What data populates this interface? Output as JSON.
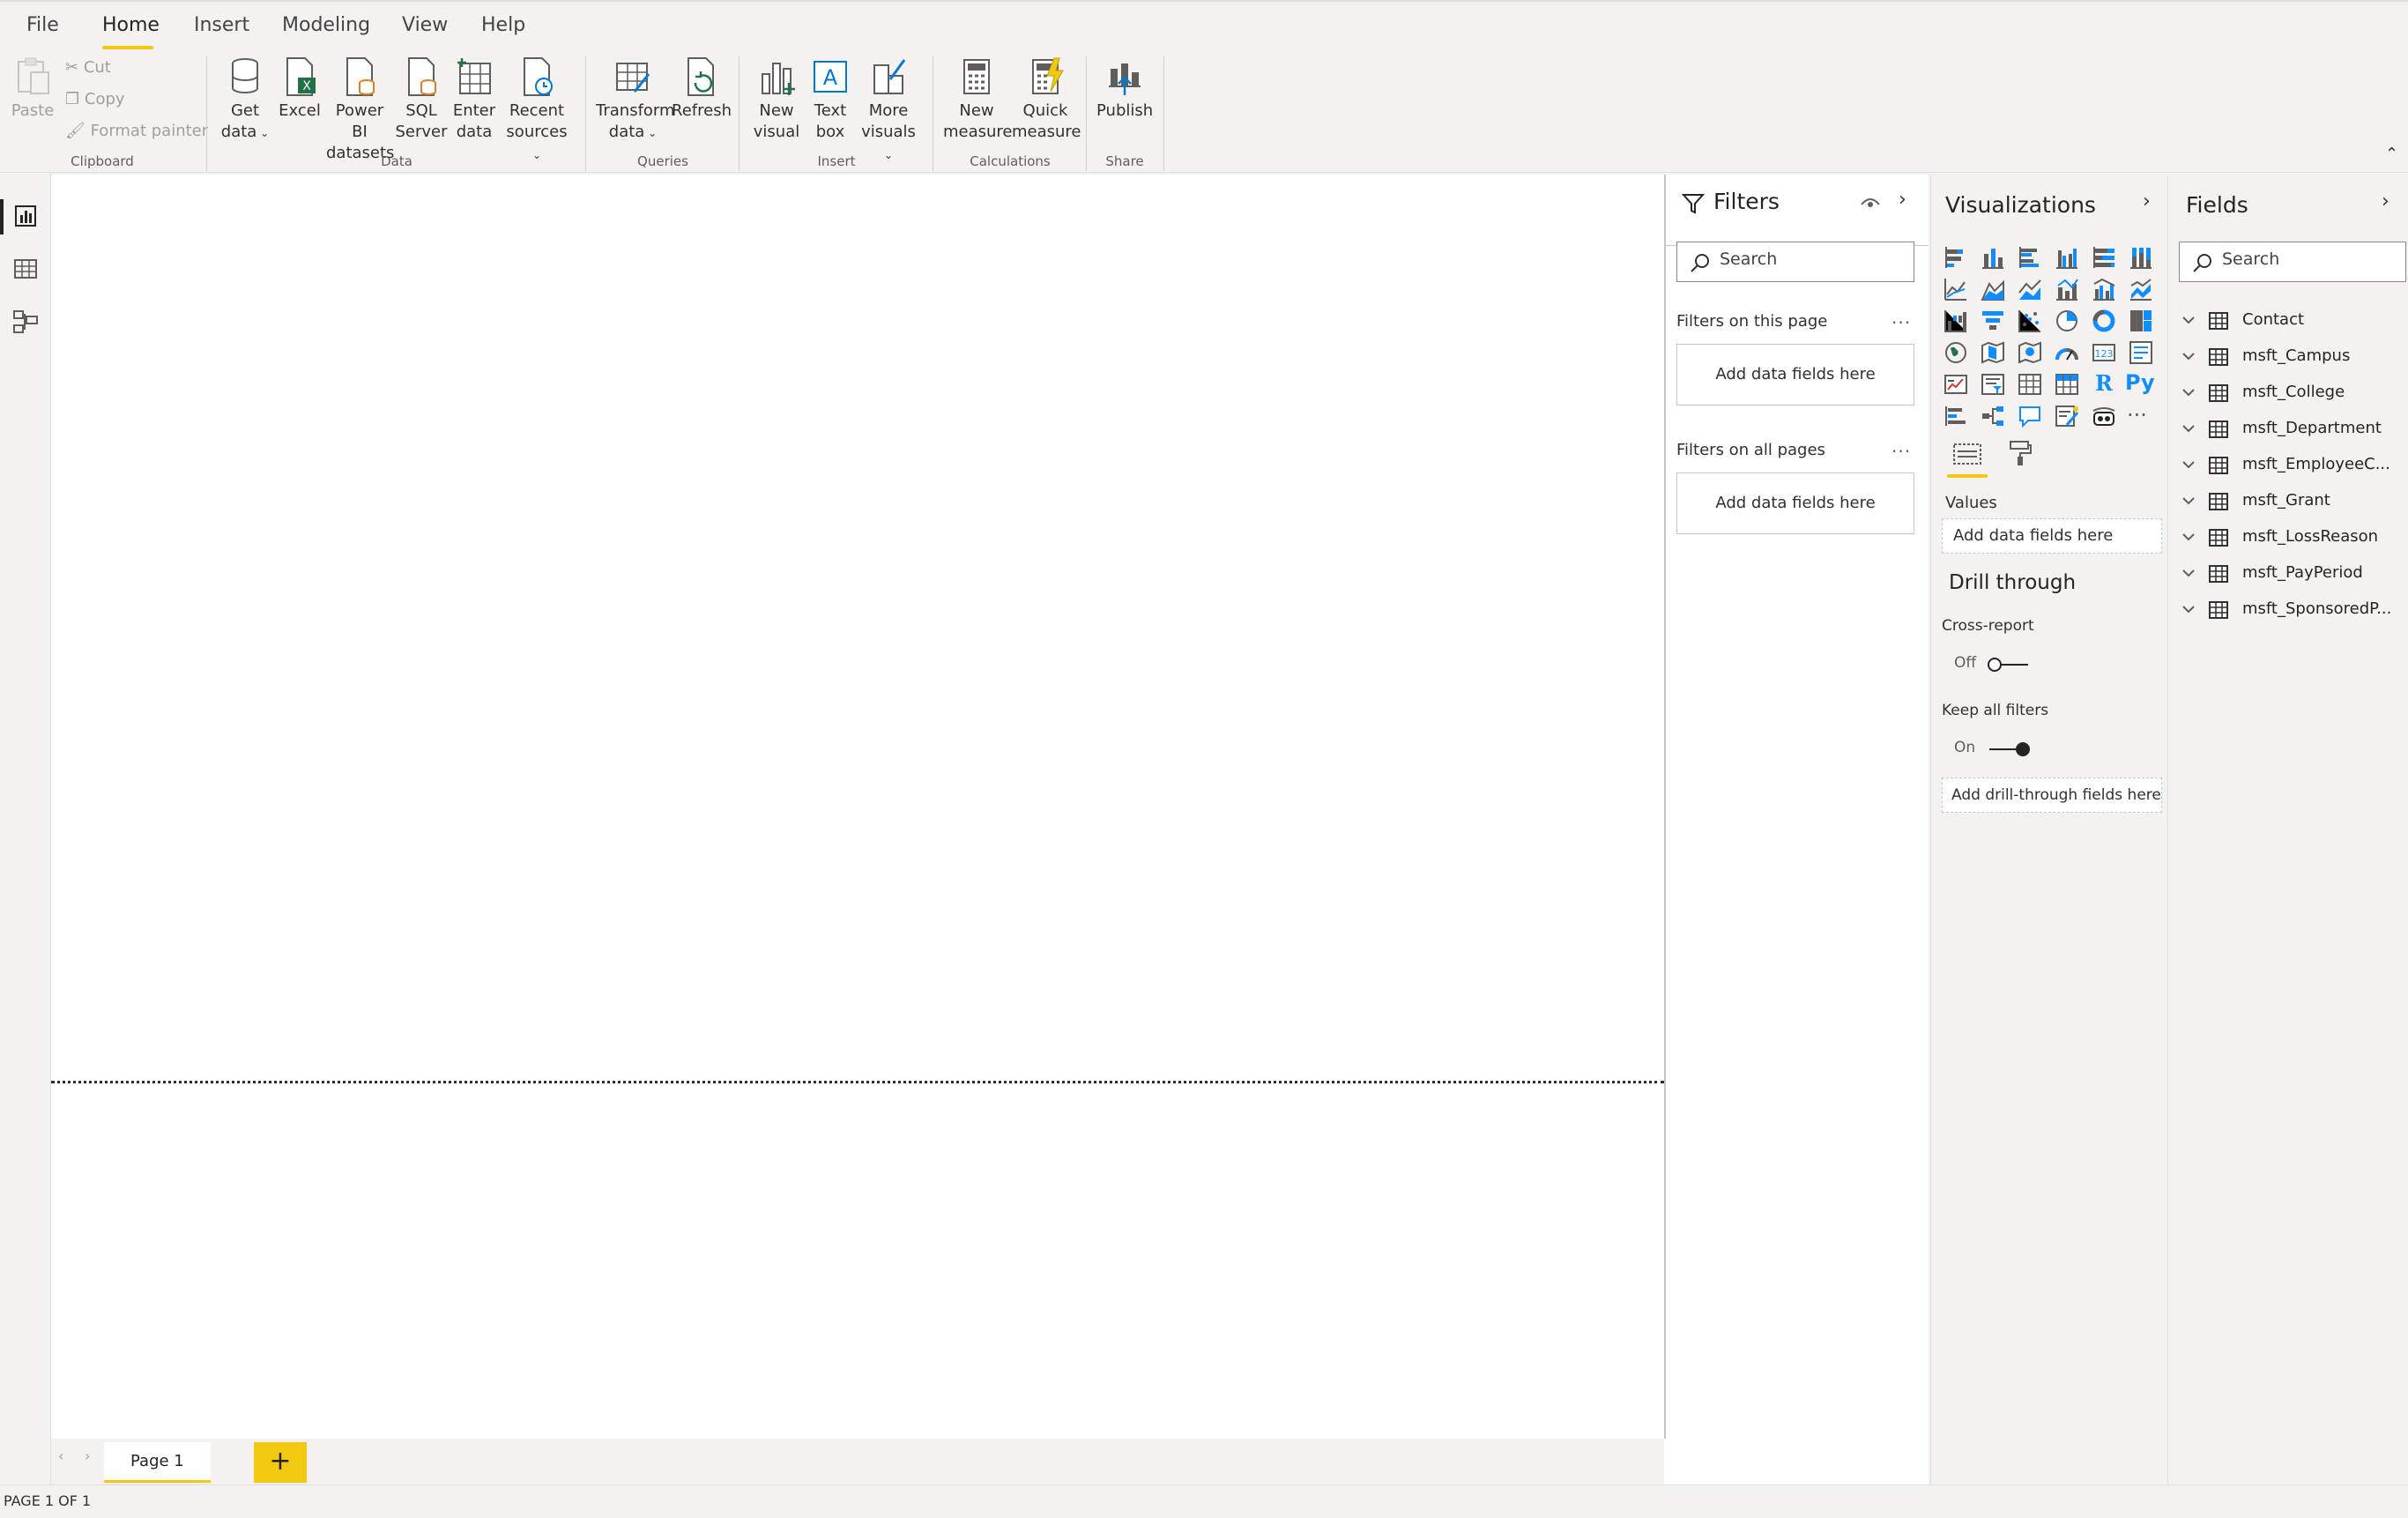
{
  "menu": {
    "items": [
      {
        "id": "file",
        "label": "File"
      },
      {
        "id": "home",
        "label": "Home"
      },
      {
        "id": "insert",
        "label": "Insert"
      },
      {
        "id": "modeling",
        "label": "Modeling"
      },
      {
        "id": "view",
        "label": "View"
      },
      {
        "id": "help",
        "label": "Help"
      }
    ],
    "active": "Home"
  },
  "ribbon": {
    "clipboard": {
      "paste": "Paste",
      "cut": "Cut",
      "copy": "Copy",
      "format_painter": "Format painter",
      "label": "Clipboard"
    },
    "data": {
      "get_data": [
        "Get",
        "data"
      ],
      "excel": [
        "Excel"
      ],
      "powerbi": [
        "Power BI",
        "datasets"
      ],
      "sql": [
        "SQL",
        "Server"
      ],
      "enter": [
        "Enter",
        "data"
      ],
      "recent": [
        "Recent",
        "sources"
      ],
      "label": "Data"
    },
    "queries": {
      "transform": [
        "Transform",
        "data"
      ],
      "refresh": [
        "Refresh"
      ],
      "label": "Queries"
    },
    "insert": {
      "new_visual": [
        "New",
        "visual"
      ],
      "text_box": [
        "Text",
        "box"
      ],
      "more_visuals": [
        "More",
        "visuals"
      ],
      "label": "Insert"
    },
    "calculations": {
      "new_measure": [
        "New",
        "measure"
      ],
      "quick_measure": [
        "Quick",
        "measure"
      ],
      "label": "Calculations"
    },
    "share": {
      "publish": [
        "Publish"
      ],
      "label": "Share"
    }
  },
  "pages": {
    "tabs": [
      "Page 1"
    ],
    "add": "+",
    "status": "PAGE 1 OF 1"
  },
  "filters": {
    "title": "Filters",
    "search_placeholder": "Search",
    "on_this_page": "Filters on this page",
    "on_all_pages": "Filters on all pages",
    "add_fields": "Add data fields here",
    "more": "..."
  },
  "visualizations": {
    "title": "Visualizations",
    "values_label": "Values",
    "values_drop": "Add data fields here",
    "drill_title": "Drill through",
    "cross_report": "Cross-report",
    "cross_report_state": "Off",
    "keep_filters": "Keep all filters",
    "keep_filters_state": "On",
    "drill_drop": "Add drill-through fields here",
    "r_label": "R",
    "py_label": "Py",
    "more": "..."
  },
  "fields": {
    "title": "Fields",
    "search_placeholder": "Search",
    "tables": [
      "Contact",
      "msft_Campus",
      "msft_College",
      "msft_Department",
      "msft_EmployeeC...",
      "msft_Grant",
      "msft_LossReason",
      "msft_PayPeriod",
      "msft_SponsoredP..."
    ]
  },
  "colors": {
    "accent": "#f2c811",
    "canvas": "#ffffff",
    "chrome": "#f3f2f1",
    "viz_blue": "#118dff",
    "text": "#252423"
  }
}
